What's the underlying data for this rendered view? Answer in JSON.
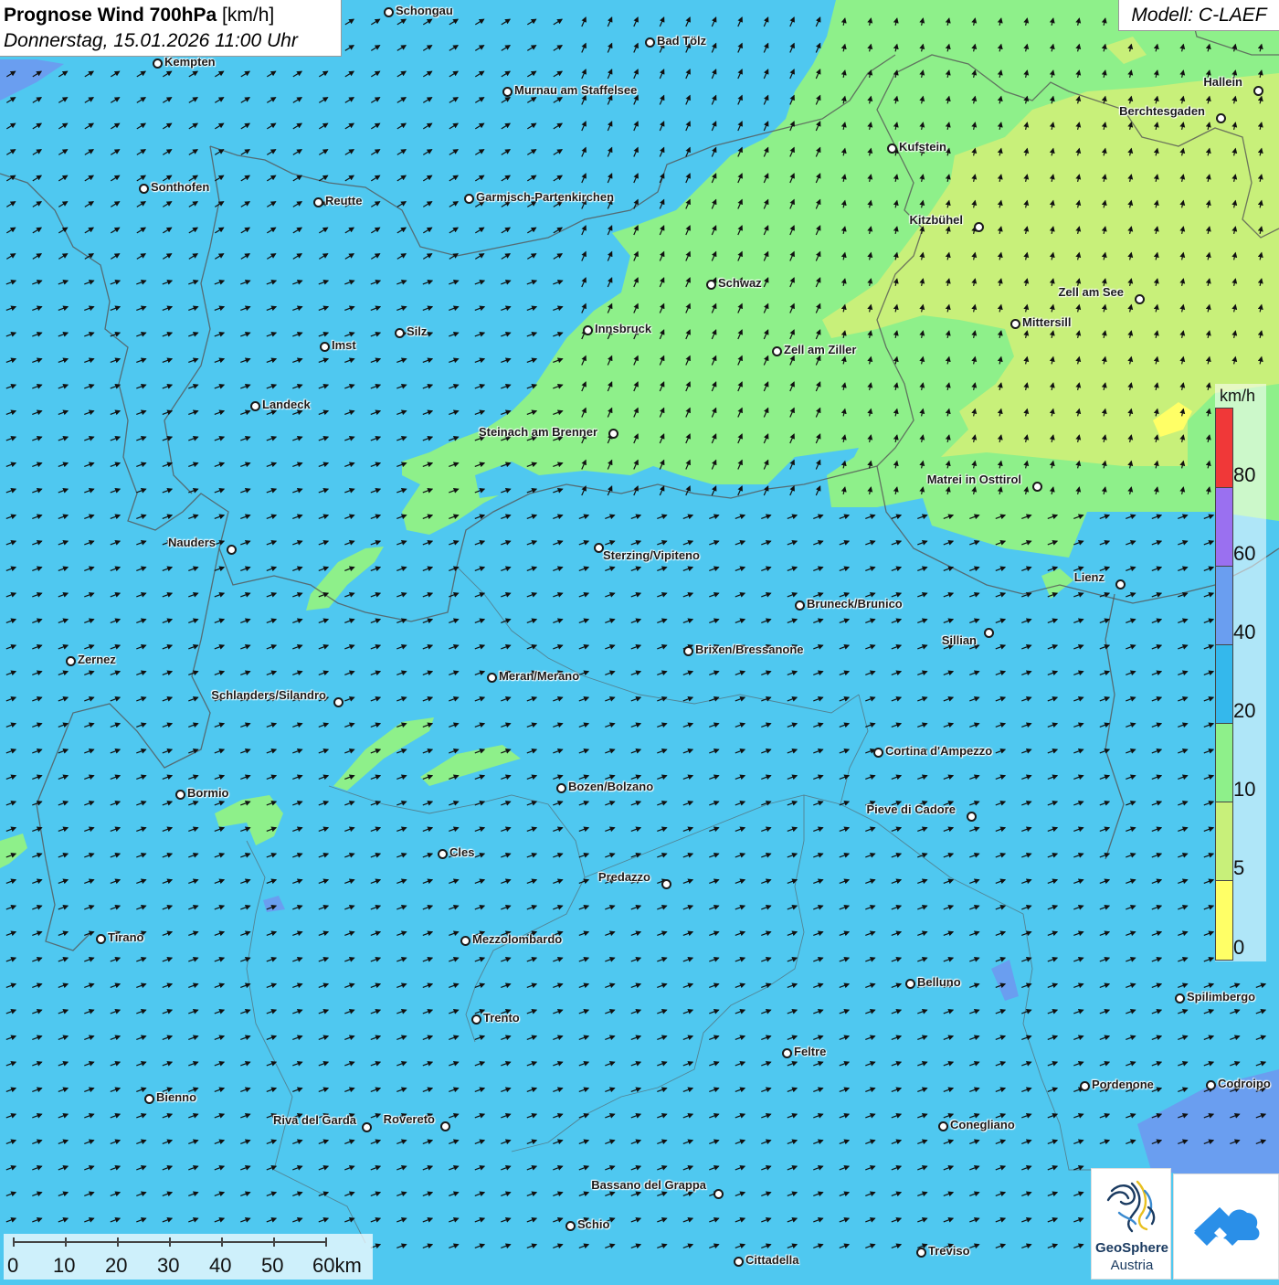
{
  "title": {
    "main": "Prognose Wind 700hPa",
    "unit": "[km/h]",
    "datetime": "Donnerstag, 15.01.2026 11:00 Uhr"
  },
  "model": "Modell: C-LAEF",
  "colors": {
    "wind_0_5": "#ffff66",
    "wind_5_10": "#c8f07a",
    "wind_10_20": "#8ef08a",
    "wind_20_40": "#4fc8f0",
    "wind_40_60": "#6a9ef0",
    "wind_60_80": "#9a70f0",
    "wind_80_plus": "#f03838"
  },
  "legend": {
    "unit": "km/h",
    "values": [
      "80",
      "60",
      "40",
      "20",
      "10",
      "5",
      "0"
    ],
    "segment_colors": [
      "#f03838",
      "#9a70f0",
      "#6a9ef0",
      "#34b8ec",
      "#8ef08a",
      "#c8f07a",
      "#ffff66"
    ]
  },
  "scale": {
    "labels": [
      "0",
      "10",
      "20",
      "30",
      "40",
      "50",
      "60km"
    ]
  },
  "logos": {
    "geosphere_name": "GeoSphere",
    "geosphere_sub": "Austria"
  },
  "cities": [
    {
      "name": "Schongau"
    },
    {
      "name": "Bad Tölz"
    },
    {
      "name": "Kempten"
    },
    {
      "name": "Murnau am Staffelsee"
    },
    {
      "name": "Hallein"
    },
    {
      "name": "Berchtesgaden"
    },
    {
      "name": "Kufstein"
    },
    {
      "name": "Sonthofen"
    },
    {
      "name": "Reutte"
    },
    {
      "name": "Garmisch-Partenkirchen"
    },
    {
      "name": "Kitzbühel"
    },
    {
      "name": "Schwaz"
    },
    {
      "name": "Zell am See"
    },
    {
      "name": "Innsbruck"
    },
    {
      "name": "Mittersill"
    },
    {
      "name": "Silz"
    },
    {
      "name": "Imst"
    },
    {
      "name": "Zell am Ziller"
    },
    {
      "name": "Landeck"
    },
    {
      "name": "Steinach am Brenner"
    },
    {
      "name": "Matrei in Osttirol"
    },
    {
      "name": "Nauders"
    },
    {
      "name": "Sterzing/Vipiteno"
    },
    {
      "name": "Lienz"
    },
    {
      "name": "Bruneck/Brunico"
    },
    {
      "name": "Sillian"
    },
    {
      "name": "Zernez"
    },
    {
      "name": "Brixen/Bressanone"
    },
    {
      "name": "Meran/Merano"
    },
    {
      "name": "Schlanders/Silandro"
    },
    {
      "name": "Cortina d'Ampezzo"
    },
    {
      "name": "Bozen/Bolzano"
    },
    {
      "name": "Bormio"
    },
    {
      "name": "Pieve di Cadore"
    },
    {
      "name": "Cles"
    },
    {
      "name": "Predazzo"
    },
    {
      "name": "Tirano"
    },
    {
      "name": "Mezzolombardo"
    },
    {
      "name": "Belluno"
    },
    {
      "name": "Spilimbergo"
    },
    {
      "name": "Trento"
    },
    {
      "name": "Feltre"
    },
    {
      "name": "Pordenone"
    },
    {
      "name": "Codroipo"
    },
    {
      "name": "Bienno"
    },
    {
      "name": "Riva del Garda"
    },
    {
      "name": "Rovereto"
    },
    {
      "name": "Conegliano"
    },
    {
      "name": "Bassano del Grappa"
    },
    {
      "name": "Schio"
    },
    {
      "name": "Treviso"
    },
    {
      "name": "Cittadella"
    }
  ]
}
